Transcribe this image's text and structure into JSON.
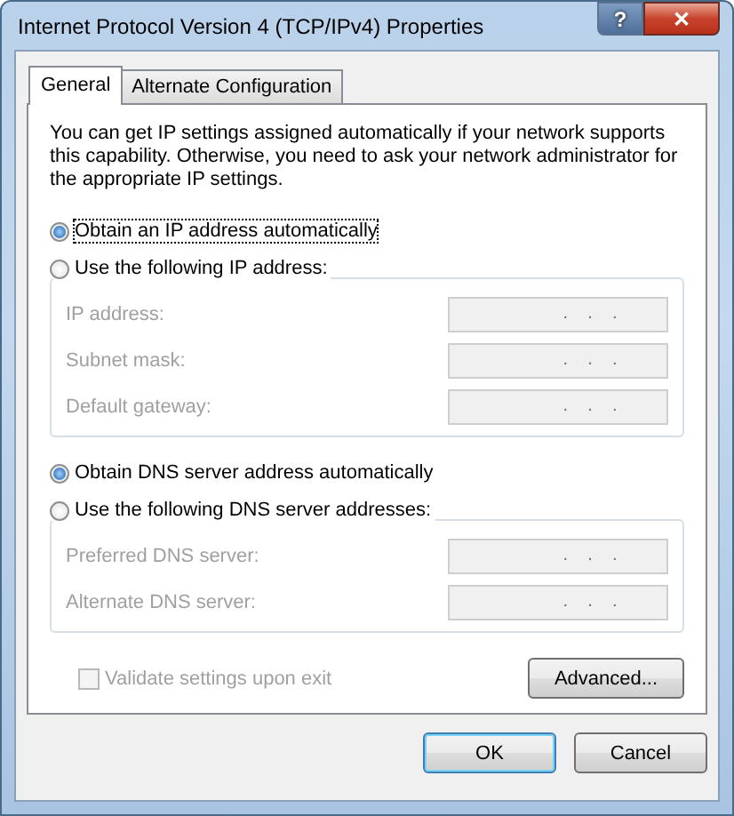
{
  "window": {
    "title": "Internet Protocol Version 4 (TCP/IPv4) Properties",
    "help": "?",
    "close": "✕"
  },
  "tabs": [
    {
      "label": "General",
      "selected": true
    },
    {
      "label": "Alternate Configuration",
      "selected": false
    }
  ],
  "intro": "You can get IP settings assigned automatically if your network supports this capability. Otherwise, you need to ask your network administrator for the appropriate IP settings.",
  "sections": [
    {
      "auto": {
        "label": "Obtain an IP address automatically",
        "selected": true,
        "focused": true
      },
      "manual": {
        "label": "Use the following IP address:",
        "selected": false
      },
      "fields": [
        {
          "label": "IP address:",
          "value": ".    .    .",
          "disabled": true
        },
        {
          "label": "Subnet mask:",
          "value": ".    .    .",
          "disabled": true
        },
        {
          "label": "Default gateway:",
          "value": ".    .    .",
          "disabled": true
        }
      ]
    },
    {
      "auto": {
        "label": "Obtain DNS server address automatically",
        "selected": true,
        "focused": false
      },
      "manual": {
        "label": "Use the following DNS server addresses:",
        "selected": false
      },
      "fields": [
        {
          "label": "Preferred DNS server:",
          "value": ".    .    .",
          "disabled": true
        },
        {
          "label": "Alternate DNS server:",
          "value": ".    .    .",
          "disabled": true
        }
      ]
    }
  ],
  "validate": {
    "label": "Validate settings upon exit",
    "checked": false,
    "disabled": true
  },
  "advanced": "Advanced...",
  "buttons": [
    {
      "label": "OK",
      "default": true
    },
    {
      "label": "Cancel",
      "default": false
    }
  ]
}
